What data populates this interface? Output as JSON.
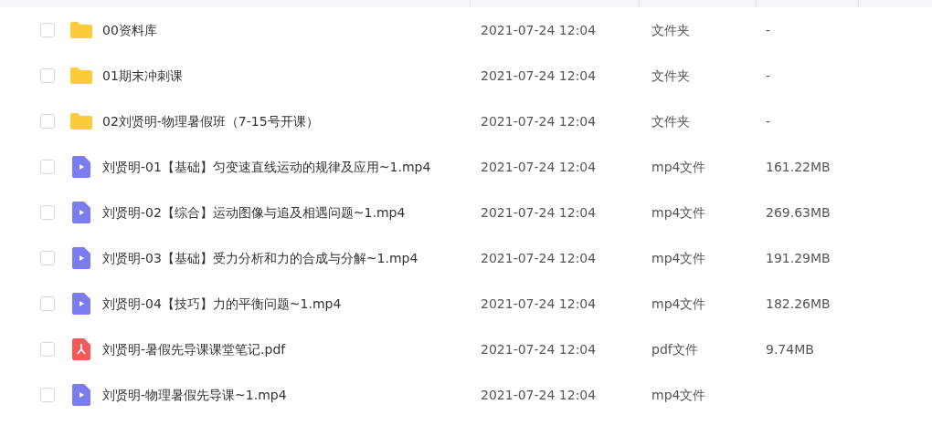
{
  "files": [
    {
      "kind": "folder",
      "name": "00资料库",
      "modified": "2021-07-24 12:04",
      "type": "文件夹",
      "size": "-",
      "checked": false
    },
    {
      "kind": "folder",
      "name": "01期末冲刺课",
      "modified": "2021-07-24 12:04",
      "type": "文件夹",
      "size": "-",
      "checked": false
    },
    {
      "kind": "folder",
      "name": "02刘贤明-物理暑假班（7-15号开课）",
      "modified": "2021-07-24 12:04",
      "type": "文件夹",
      "size": "-",
      "checked": false
    },
    {
      "kind": "video",
      "name": "刘贤明-01【基础】匀变速直线运动的规律及应用~1.mp4",
      "modified": "2021-07-24 12:04",
      "type": "mp4文件",
      "size": "161.22MB",
      "checked": false
    },
    {
      "kind": "video",
      "name": "刘贤明-02【综合】运动图像与追及相遇问题~1.mp4",
      "modified": "2021-07-24 12:04",
      "type": "mp4文件",
      "size": "269.63MB",
      "checked": false
    },
    {
      "kind": "video",
      "name": "刘贤明-03【基础】受力分析和力的合成与分解~1.mp4",
      "modified": "2021-07-24 12:04",
      "type": "mp4文件",
      "size": "191.29MB",
      "checked": false
    },
    {
      "kind": "video",
      "name": "刘贤明-04【技巧】力的平衡问题~1.mp4",
      "modified": "2021-07-24 12:04",
      "type": "mp4文件",
      "size": "182.26MB",
      "checked": false
    },
    {
      "kind": "pdf",
      "name": "刘贤明-暑假先导课课堂笔记.pdf",
      "modified": "2021-07-24 12:04",
      "type": "pdf文件",
      "size": "9.74MB",
      "checked": false
    },
    {
      "kind": "video",
      "name": "刘贤明-物理暑假先导课~1.mp4",
      "modified": "2021-07-24 12:04",
      "type": "mp4文件",
      "checked": false
    }
  ]
}
